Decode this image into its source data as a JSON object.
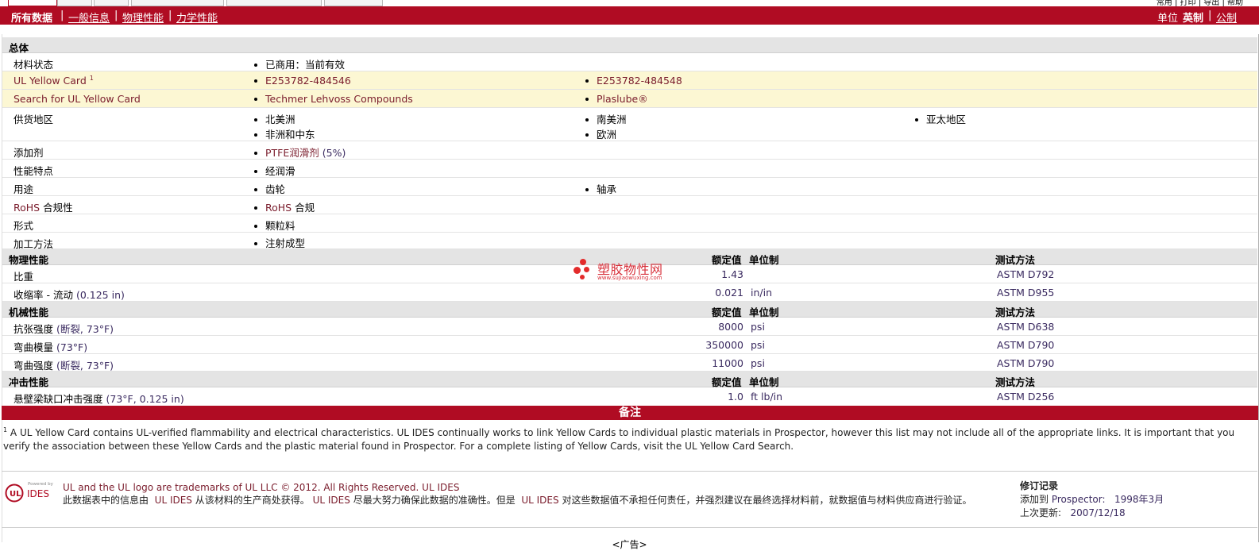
{
  "top_links": "常用 | 打印 | 导出 | 帮助",
  "nav": {
    "all_data": "所有数据",
    "general": "一般信息",
    "physical": "物理性能",
    "mechanical": "力学性能",
    "units_label": "单位",
    "imperial": "英制",
    "metric": "公制"
  },
  "general": {
    "title": "总体",
    "material_status_label": "材料状态",
    "material_status": "已商用：当前有效",
    "yellow_card_label": "UL Yellow Card",
    "yellow_card_sup": "1",
    "yellow_cards": [
      "E253782-484546",
      "E253782-484548"
    ],
    "search_label": "Search for UL Yellow Card",
    "search_items": [
      "Techmer Lehvoss Compounds",
      "Plaslube®"
    ],
    "supply_label": "供货地区",
    "supply_regions": [
      "北美洲",
      "南美洲",
      "亚太地区",
      "非洲和中东",
      "欧洲"
    ],
    "additive_label": "添加剂",
    "additive_name": "PTFE润滑剂",
    "additive_pct": "(5%)",
    "features_label": "性能特点",
    "features": [
      "经润滑"
    ],
    "uses_label": "用途",
    "uses": [
      "齿轮",
      "轴承"
    ],
    "rohs_label_a": "RoHS",
    "rohs_label_b": "合规性",
    "rohs_value_a": "RoHS",
    "rohs_value_b": "合规",
    "form_label": "形式",
    "form": "颗粒料",
    "process_label": "加工方法",
    "process": "注射成型"
  },
  "headers": {
    "nominal": "额定值",
    "unit": "单位制",
    "method": "测试方法"
  },
  "physical": {
    "title": "物理性能",
    "rows": [
      {
        "prop": "比重",
        "cond": "",
        "value": "1.43",
        "unit": "",
        "method": "ASTM D792"
      },
      {
        "prop": "收缩率",
        "cond_pre": " - 流动",
        "cond": "(0.125 in)",
        "value": "0.021",
        "unit": "in/in",
        "method": "ASTM D955"
      }
    ]
  },
  "mechanical": {
    "title": "机械性能",
    "rows": [
      {
        "prop": "抗张强度",
        "cond": "(断裂, 73°F)",
        "value": "8000",
        "unit": "psi",
        "method": "ASTM D638"
      },
      {
        "prop": "弯曲模量",
        "cond": "(73°F)",
        "value": "350000",
        "unit": "psi",
        "method": "ASTM D790"
      },
      {
        "prop": "弯曲强度",
        "cond": "(断裂, 73°F)",
        "value": "11000",
        "unit": "psi",
        "method": "ASTM D790"
      }
    ]
  },
  "impact": {
    "title": "冲击性能",
    "rows": [
      {
        "prop": "悬壁梁缺口冲击强度",
        "cond": "(73°F, 0.125 in)",
        "value": "1.0",
        "unit": "ft lb/in",
        "method": "ASTM D256"
      }
    ]
  },
  "notes": {
    "title": "备注",
    "sup": "1",
    "text": "A UL Yellow Card contains UL-verified flammability and electrical characteristics. UL IDES continually works to link Yellow Cards to individual plastic materials in Prospector, however this list may not include all of the appropriate links. It is important that you verify the association between these Yellow Cards and the plastic material found in Prospector. For a complete listing of Yellow Cards, visit the UL Yellow Card Search."
  },
  "watermark": {
    "text": "塑胶物性网",
    "url": "www.sujiaowuxing.com"
  },
  "logo": {
    "powered": "Powered by",
    "ul": "UL",
    "ides": "IDES"
  },
  "footer": {
    "line1": "UL and the UL logo are trademarks of UL LLC © 2012. All Rights Reserved. UL IDES",
    "p1": "此数据表中的信息由",
    "ul1": "UL IDES",
    "p2": "从该材料的生产商处获得。",
    "ul2": "UL IDES",
    "p3": "尽最大努力确保此数据的准确性。但是",
    "ul3": "UL IDES",
    "p4": "对这些数据值不承担任何责任，并强烈建议在最终选择材料前，就数据值与材料供应商进行验证。"
  },
  "revision": {
    "title": "修订记录",
    "added_label": "添加到",
    "added_site": "Prospector:",
    "added_date": "1998年3月",
    "updated_label": "上次更新:",
    "updated_date": "2007/12/18"
  },
  "ad": "<广告>",
  "colors": {
    "brand_red": "#b00c23",
    "highlight": "#fcf7d3",
    "section_gray": "#e4e4e4"
  }
}
